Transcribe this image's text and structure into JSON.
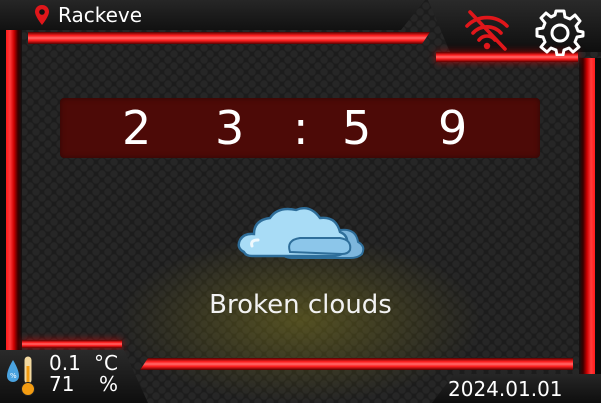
{
  "header": {
    "location": "Rackeve",
    "location_icon": "map-pin-icon",
    "wifi_icon": "wifi-off-icon",
    "settings_icon": "gear-icon"
  },
  "clock": {
    "digits": [
      "2",
      "3",
      ":",
      "5",
      "9"
    ]
  },
  "weather": {
    "icon": "cloud-icon",
    "description": "Broken clouds"
  },
  "sensors": {
    "temperature": "0.1",
    "temperature_unit": "°C",
    "humidity": "71",
    "humidity_unit": "%"
  },
  "date": "2024.01.01",
  "colors": {
    "accent": "#ff1e1e",
    "clock_bg": "#4d0a07",
    "wifi_off": "#e0161a",
    "cloud": "#9fd2f2"
  }
}
